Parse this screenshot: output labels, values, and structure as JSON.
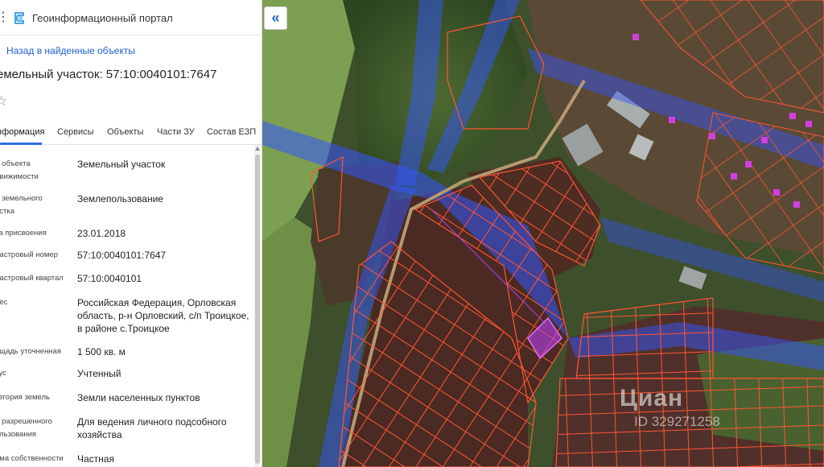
{
  "header": {
    "menu_icon": "menu-icon",
    "logo_icon": "portal-logo-icon",
    "title": "Геоинформационный портал"
  },
  "back_link": "Назад в найденные объекты",
  "parcel_title": "емельный участок: 57:10:0040101:7647",
  "favorite_icon": "star-icon",
  "tabs": [
    {
      "label": "нформация",
      "active": true
    },
    {
      "label": "Сервисы"
    },
    {
      "label": "Объекты"
    },
    {
      "label": "Части ЗУ"
    },
    {
      "label": "Состав ЕЗП"
    }
  ],
  "attributes": [
    {
      "label": "д объекта\nдвижимости",
      "value": "Земельный участок"
    },
    {
      "label": "д земельного\nастка",
      "value": "Землепользование"
    },
    {
      "label": "та присвоения",
      "value": "23.01.2018"
    },
    {
      "label": "дастровый номер",
      "value": "57:10:0040101:7647"
    },
    {
      "label": "дастровый квартал",
      "value": "57:10:0040101"
    },
    {
      "label": "рес",
      "value": "Российская Федерация, Орловская область, р-н Орловский, с/п Троицкое, в районе с.Троицкое"
    },
    {
      "label": "ощадь уточненная",
      "value": "1 500 кв. м"
    },
    {
      "label": "тус",
      "value": "Учтенный"
    },
    {
      "label": "тегория земель",
      "value": "Земли населенных пунктов"
    },
    {
      "label": "д разрешенного\nользования",
      "value": "Для ведения личного подсобного хозяйства"
    },
    {
      "label": "рма собственности",
      "value": "Частная"
    }
  ],
  "map": {
    "collapse_icon": "double-chevron-left-icon",
    "collapse_label": "«",
    "watermark_logo": "Циан",
    "watermark_id": "ID 329271258",
    "colors": {
      "field": "#5a3a2c",
      "vegetation": "#3c5a2a",
      "light_field": "#7a9a4a",
      "zone_overlay": "#3355ff",
      "parcel_border": "#ff5533",
      "highlight": "#c040ff"
    }
  }
}
